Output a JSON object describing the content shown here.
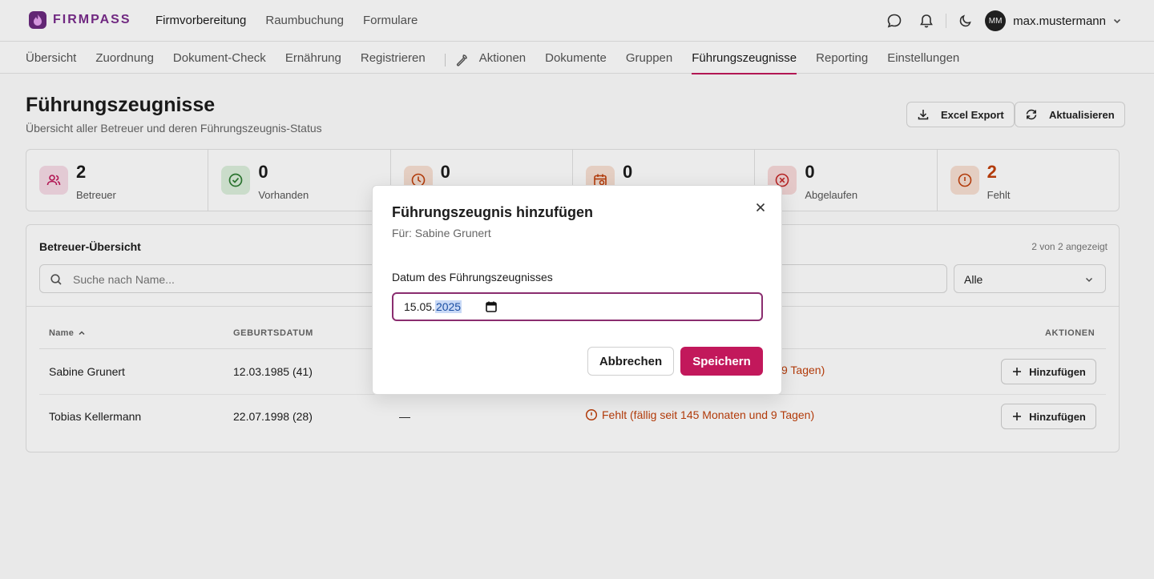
{
  "app": {
    "brand": "FIRMPASS",
    "brand_color": "#7a2c8c",
    "accent_color": "#c2185b",
    "main_nav": [
      "Firmvorbereitung",
      "Raumbuchung",
      "Formulare"
    ],
    "main_nav_active": "Firmvorbereitung",
    "user": {
      "initials": "MM",
      "name": "max.mustermann"
    }
  },
  "subnav": {
    "items_left": [
      "Übersicht",
      "Zuordnung",
      "Dokument-Check",
      "Ernährung",
      "Registrieren"
    ],
    "items_right": [
      "Aktionen",
      "Dokumente",
      "Gruppen",
      "Führungszeugnisse",
      "Reporting",
      "Einstellungen"
    ],
    "active": "Führungszeugnisse"
  },
  "page": {
    "title": "Führungszeugnisse",
    "subtitle": "Übersicht aller Betreuer und deren Führungszeugnis-Status",
    "export_label": "Excel Export",
    "refresh_label": "Aktualisieren"
  },
  "stats": [
    {
      "value": "2",
      "label": "Betreuer",
      "icon": "users-icon",
      "color": "#c2185b"
    },
    {
      "value": "0",
      "label": "Vorhanden",
      "icon": "check-circle-icon",
      "color": "#2e7d32"
    },
    {
      "value": "0",
      "label": "",
      "icon": "clock-icon",
      "color": "#c2410c"
    },
    {
      "value": "0",
      "label": "",
      "icon": "calendar-alert-icon",
      "color": "#c2410c"
    },
    {
      "value": "0",
      "label": "Abgelaufen",
      "icon": "x-circle-icon",
      "color": "#c62828"
    },
    {
      "value": "2",
      "label": "Fehlt",
      "icon": "alert-circle-icon",
      "color": "#c2410c"
    }
  ],
  "overview": {
    "title": "Betreuer-Übersicht",
    "count_text": "2 von 2 angezeigt",
    "search_placeholder": "Suche nach Name...",
    "filter_value": "Alle",
    "columns": {
      "name": "Name",
      "birth": "GEBURTSDATUM",
      "actions": "AKTIONEN"
    },
    "rows": [
      {
        "name": "Sabine Grunert",
        "birth": "12.03.1985 (41)",
        "date": "",
        "status": "9 Tagen)",
        "action": "Hinzufügen"
      },
      {
        "name": "Tobias Kellermann",
        "birth": "22.07.1998 (28)",
        "date": "—",
        "status": "Fehlt (fällig seit 145 Monaten und 9 Tagen)",
        "action": "Hinzufügen"
      }
    ]
  },
  "modal": {
    "title": "Führungszeugnis hinzufügen",
    "subtitle": "Für: Sabine Grunert",
    "field_label": "Datum des Führungszeugnisses",
    "date_day_month": "15.05.",
    "date_year": "2025",
    "cancel_label": "Abbrechen",
    "save_label": "Speichern"
  }
}
